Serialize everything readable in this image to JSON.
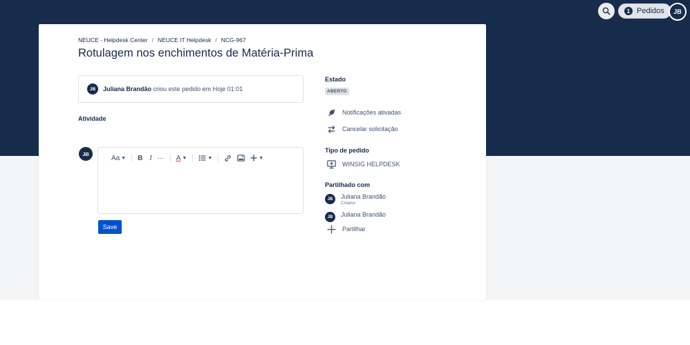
{
  "header": {
    "requests_label": "Pedidos",
    "requests_count": "1",
    "user_initials": "JB"
  },
  "breadcrumb": [
    "NEUCE - Helpdesk Center",
    "NEUCE IT Helpdesk",
    "NCG-967"
  ],
  "request": {
    "title": "Rotulagem nos enchimentos de Matéria-Prima",
    "creator_initials": "JB",
    "creator_name": "Juliana Brandão",
    "created_text": "criou este pedido em Hoje 01:01"
  },
  "activity": {
    "label": "Atividade",
    "commenter_initials": "JB",
    "toolbar": {
      "text_style": "Aa",
      "bold": "B",
      "italic": "I",
      "more": "···",
      "text_color": "A"
    },
    "save_label": "Save"
  },
  "sidebar": {
    "status_heading": "Estado",
    "status_value": "ABERTO",
    "notifications_label": "Notificações ativadas",
    "cancel_label": "Cancelar solicitação",
    "request_type_heading": "Tipo de pedido",
    "request_type_value": "WINSIG HELPDESK",
    "shared_heading": "Partilhado com",
    "shared_with": [
      {
        "initials": "JB",
        "name": "Juliana Brandão",
        "role": "Criador"
      },
      {
        "initials": "JB",
        "name": "Juliana Brandão",
        "role": ""
      }
    ],
    "share_label": "Partilhar"
  },
  "colors": {
    "header_bg": "#172b4d",
    "primary_button": "#0052cc",
    "page_bg_lower": "#f4f5f7"
  }
}
